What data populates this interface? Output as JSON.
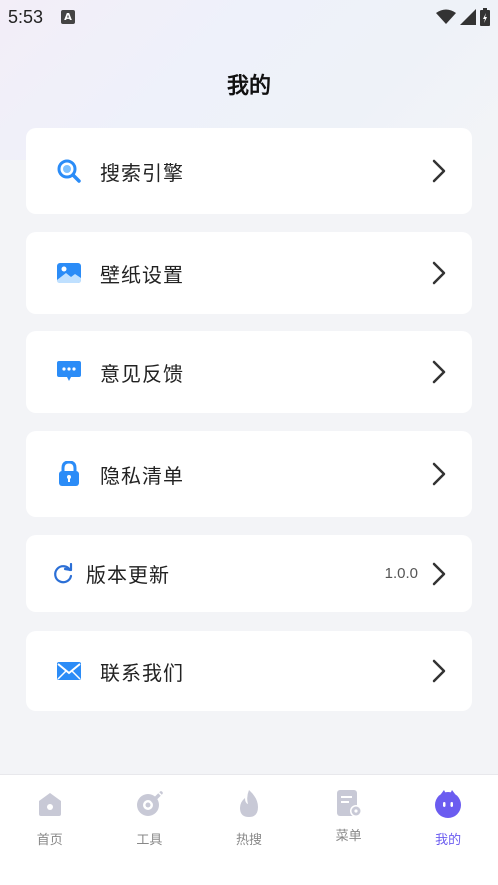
{
  "status": {
    "time": "5:53",
    "notif": "A"
  },
  "page": {
    "title": "我的"
  },
  "menu": [
    {
      "label": "搜索引擎",
      "icon": "search-icon"
    },
    {
      "label": "壁纸设置",
      "icon": "image-icon"
    },
    {
      "label": "意见反馈",
      "icon": "chat-icon"
    },
    {
      "label": "隐私清单",
      "icon": "lock-icon"
    },
    {
      "label": "版本更新",
      "icon": "refresh-icon",
      "value": "1.0.0"
    },
    {
      "label": "联系我们",
      "icon": "mail-icon"
    }
  ],
  "tabs": [
    {
      "label": "首页",
      "icon": "home-icon"
    },
    {
      "label": "工具",
      "icon": "tools-icon"
    },
    {
      "label": "热搜",
      "icon": "flame-icon"
    },
    {
      "label": "菜单",
      "icon": "menu-doc-icon"
    },
    {
      "label": "我的",
      "icon": "profile-icon",
      "active": true
    }
  ],
  "colors": {
    "accent": "#2b8cf7",
    "tab_active": "#6b5cf0",
    "tab_inactive": "#c8c9d6"
  }
}
